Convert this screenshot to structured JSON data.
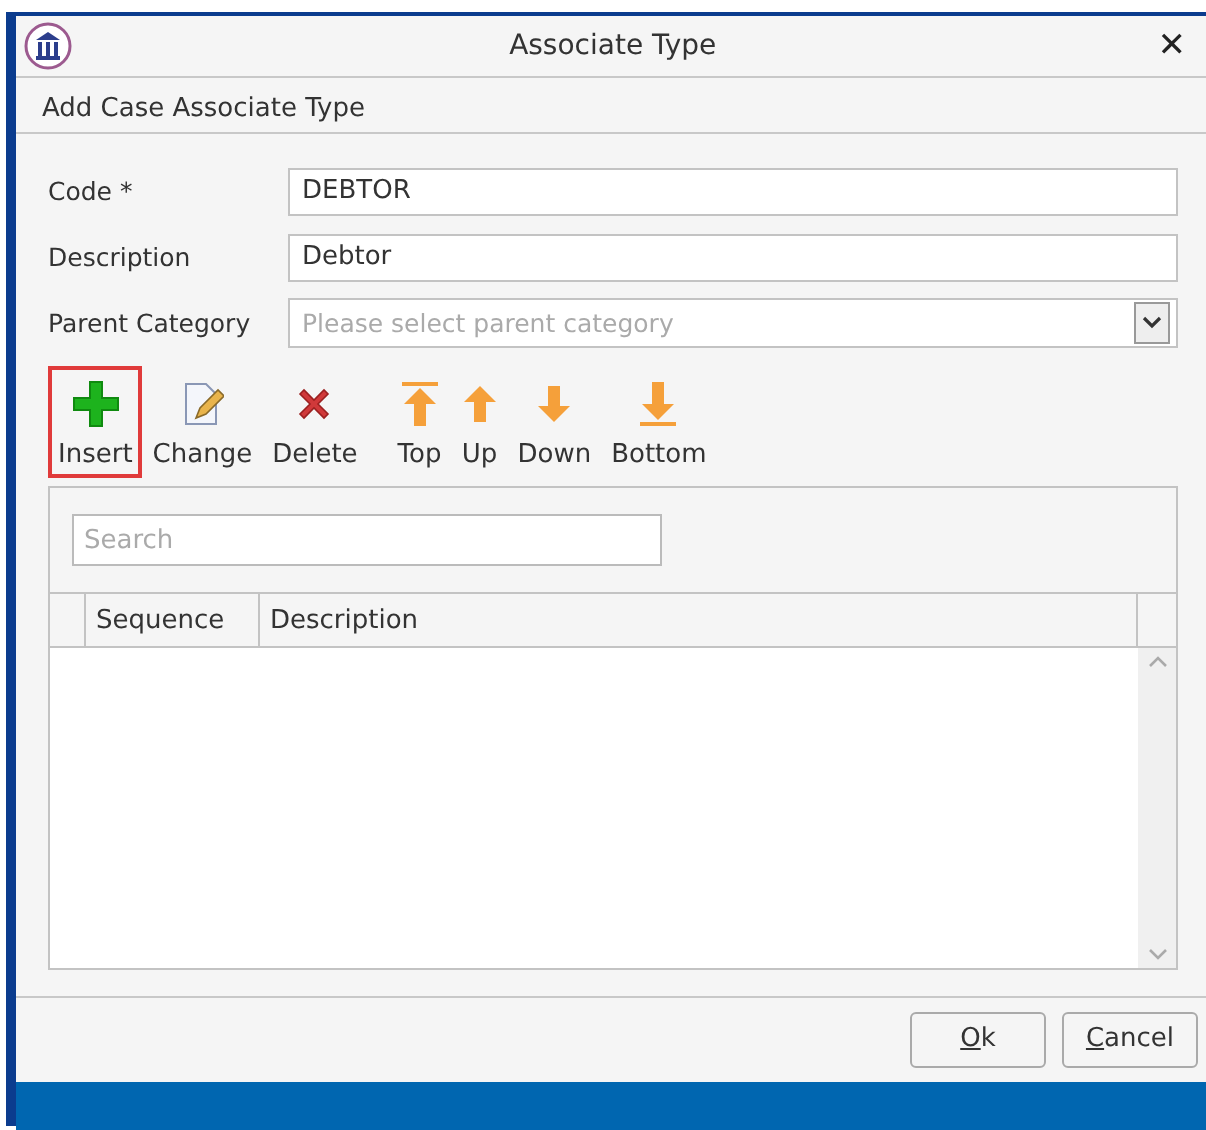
{
  "window": {
    "title": "Associate Type",
    "close": "✕"
  },
  "section": {
    "title": "Add Case Associate Type"
  },
  "form": [
    {
      "kind": "text",
      "label": "Code *",
      "value": "DEBTOR"
    },
    {
      "kind": "text",
      "label": "Description",
      "value": "Debtor"
    },
    {
      "kind": "dropdown",
      "label": "Parent Category",
      "placeholder": "Please select parent category"
    }
  ],
  "toolbar": [
    {
      "kind": "insert",
      "label": "Insert",
      "selected": true
    },
    {
      "kind": "change",
      "label": "Change",
      "selected": false
    },
    {
      "kind": "delete",
      "label": "Delete",
      "selected": false
    },
    {
      "kind": "top",
      "label": "Top",
      "selected": false
    },
    {
      "kind": "up",
      "label": "Up",
      "selected": false
    },
    {
      "kind": "down",
      "label": "Down",
      "selected": false
    },
    {
      "kind": "bottom",
      "label": "Bottom",
      "selected": false
    }
  ],
  "grid": {
    "search": {
      "placeholder": "Search"
    },
    "columns": [
      "Sequence",
      "Description"
    ]
  },
  "buttons": [
    {
      "key": "O",
      "rest": "k"
    },
    {
      "key": "C",
      "rest": "ancel"
    }
  ]
}
